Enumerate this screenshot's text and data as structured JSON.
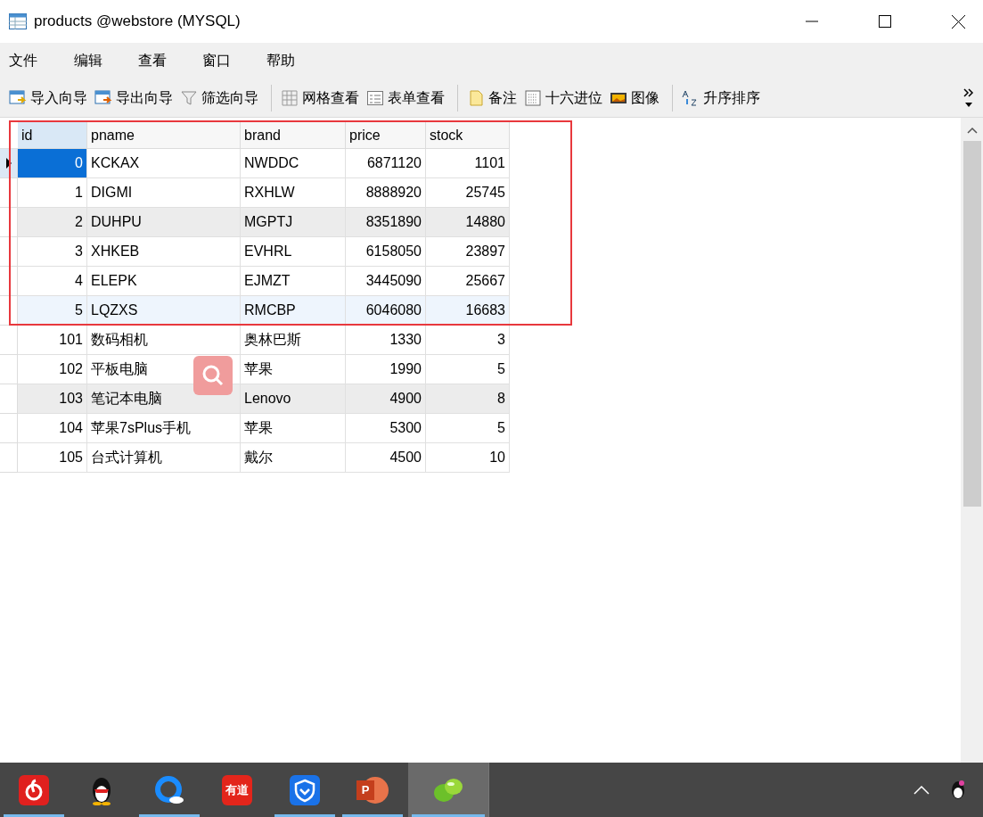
{
  "window": {
    "title": "products @webstore (MYSQL)"
  },
  "menu": [
    "文件",
    "编辑",
    "查看",
    "窗口",
    "帮助"
  ],
  "toolbar": [
    {
      "kind": "import",
      "label": "导入向导"
    },
    {
      "kind": "export",
      "label": "导出向导"
    },
    {
      "kind": "filter",
      "label": "筛选向导"
    },
    {
      "kind": "separator"
    },
    {
      "kind": "grid",
      "label": "网格查看"
    },
    {
      "kind": "form",
      "label": "表单查看"
    },
    {
      "kind": "separator"
    },
    {
      "kind": "note",
      "label": "备注"
    },
    {
      "kind": "hex",
      "label": "十六进位"
    },
    {
      "kind": "image",
      "label": "图像"
    },
    {
      "kind": "separator"
    },
    {
      "kind": "sort",
      "label": "升序排序"
    }
  ],
  "table": {
    "columns": [
      "id",
      "pname",
      "brand",
      "price",
      "stock"
    ],
    "rows": [
      {
        "cells": [
          "0",
          "KCKAX",
          "NWDDC",
          "6871120",
          "1101"
        ],
        "selected": true,
        "shaded": false,
        "focused": false
      },
      {
        "cells": [
          "1",
          "DIGMI",
          "RXHLW",
          "8888920",
          "25745"
        ],
        "selected": false,
        "shaded": false,
        "focused": false
      },
      {
        "cells": [
          "2",
          "DUHPU",
          "MGPTJ",
          "8351890",
          "14880"
        ],
        "selected": false,
        "shaded": true,
        "focused": false
      },
      {
        "cells": [
          "3",
          "XHKEB",
          "EVHRL",
          "6158050",
          "23897"
        ],
        "selected": false,
        "shaded": false,
        "focused": false
      },
      {
        "cells": [
          "4",
          "ELEPK",
          "EJMZT",
          "3445090",
          "25667"
        ],
        "selected": false,
        "shaded": false,
        "focused": false
      },
      {
        "cells": [
          "5",
          "LQZXS",
          "RMCBP",
          "6046080",
          "16683"
        ],
        "selected": false,
        "shaded": false,
        "focused": true
      },
      {
        "cells": [
          "101",
          "数码相机",
          "奥林巴斯",
          "1330",
          "3"
        ],
        "selected": false,
        "shaded": false,
        "focused": false
      },
      {
        "cells": [
          "102",
          "平板电脑",
          "苹果",
          "1990",
          "5"
        ],
        "selected": false,
        "shaded": false,
        "focused": false
      },
      {
        "cells": [
          "103",
          "笔记本电脑",
          "Lenovo",
          "4900",
          "8"
        ],
        "selected": false,
        "shaded": true,
        "focused": false
      },
      {
        "cells": [
          "104",
          "苹果7sPlus手机",
          "苹果",
          "5300",
          "5"
        ],
        "selected": false,
        "shaded": false,
        "focused": false
      },
      {
        "cells": [
          "105",
          "台式计算机",
          "戴尔",
          "4500",
          "10"
        ],
        "selected": false,
        "shaded": false,
        "focused": false
      }
    ]
  },
  "taskbar": [
    {
      "kind": "music",
      "running": true,
      "selected": false
    },
    {
      "kind": "penguin",
      "running": false,
      "selected": false
    },
    {
      "kind": "browser",
      "running": true,
      "selected": false
    },
    {
      "kind": "dictionary",
      "label": "有道",
      "running": false,
      "selected": false
    },
    {
      "kind": "shield",
      "running": true,
      "selected": false
    },
    {
      "kind": "slides",
      "label": "P",
      "running": true,
      "selected": false
    },
    {
      "kind": "database",
      "running": true,
      "selected": true
    }
  ]
}
